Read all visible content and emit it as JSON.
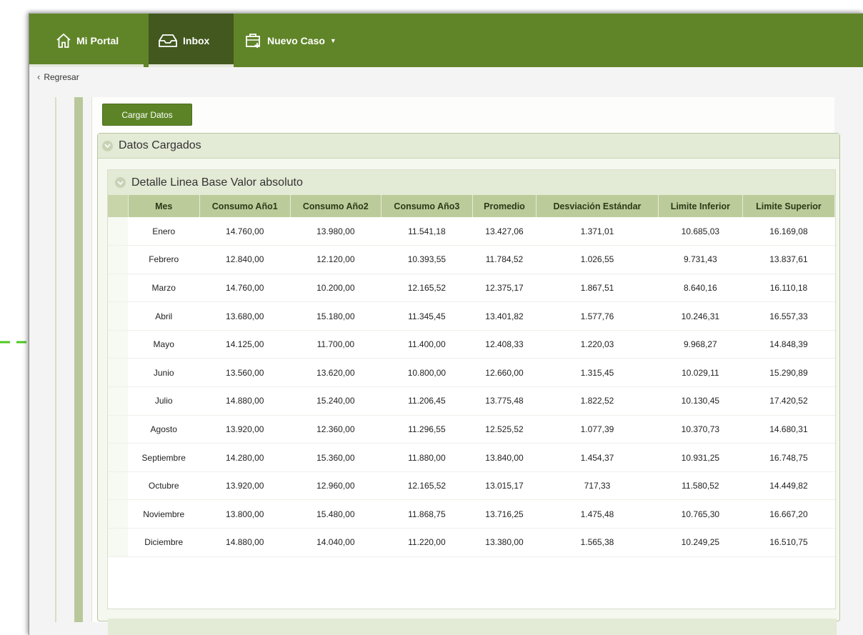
{
  "nav": {
    "portal_label": "Mi Portal",
    "inbox_label": "Inbox",
    "nuevo_label": "Nuevo Caso",
    "caret": "▼"
  },
  "back_label": "Regresar",
  "cargar_label": "Cargar Datos",
  "panel_outer_title": "Datos Cargados",
  "panel_inner_title": "Detalle Linea Base Valor absoluto",
  "colors": {
    "brand": "#608528",
    "brand_dark": "#42581f",
    "arrow": "#4cc91f"
  },
  "table": {
    "headers": [
      "Mes",
      "Consumo Año1",
      "Consumo Año2",
      "Consumo Año3",
      "Promedio",
      "Desviación Estándar",
      "Limite Inferior",
      "Limite Superior"
    ],
    "rows": [
      [
        "Enero",
        "14.760,00",
        "13.980,00",
        "11.541,18",
        "13.427,06",
        "1.371,01",
        "10.685,03",
        "16.169,08"
      ],
      [
        "Febrero",
        "12.840,00",
        "12.120,00",
        "10.393,55",
        "11.784,52",
        "1.026,55",
        "9.731,43",
        "13.837,61"
      ],
      [
        "Marzo",
        "14.760,00",
        "10.200,00",
        "12.165,52",
        "12.375,17",
        "1.867,51",
        "8.640,16",
        "16.110,18"
      ],
      [
        "Abril",
        "13.680,00",
        "15.180,00",
        "11.345,45",
        "13.401,82",
        "1.577,76",
        "10.246,31",
        "16.557,33"
      ],
      [
        "Mayo",
        "14.125,00",
        "11.700,00",
        "11.400,00",
        "12.408,33",
        "1.220,03",
        "9.968,27",
        "14.848,39"
      ],
      [
        "Junio",
        "13.560,00",
        "13.620,00",
        "10.800,00",
        "12.660,00",
        "1.315,45",
        "10.029,11",
        "15.290,89"
      ],
      [
        "Julio",
        "14.880,00",
        "15.240,00",
        "11.206,45",
        "13.775,48",
        "1.822,52",
        "10.130,45",
        "17.420,52"
      ],
      [
        "Agosto",
        "13.920,00",
        "12.360,00",
        "11.296,55",
        "12.525,52",
        "1.077,39",
        "10.370,73",
        "14.680,31"
      ],
      [
        "Septiembre",
        "14.280,00",
        "15.360,00",
        "11.880,00",
        "13.840,00",
        "1.454,37",
        "10.931,25",
        "16.748,75"
      ],
      [
        "Octubre",
        "13.920,00",
        "12.960,00",
        "12.165,52",
        "13.015,17",
        "717,33",
        "11.580,52",
        "14.449,82"
      ],
      [
        "Noviembre",
        "13.800,00",
        "15.480,00",
        "11.868,75",
        "13.716,25",
        "1.475,48",
        "10.765,30",
        "16.667,20"
      ],
      [
        "Diciembre",
        "14.880,00",
        "14.040,00",
        "11.220,00",
        "13.380,00",
        "1.565,38",
        "10.249,25",
        "16.510,75"
      ]
    ]
  }
}
